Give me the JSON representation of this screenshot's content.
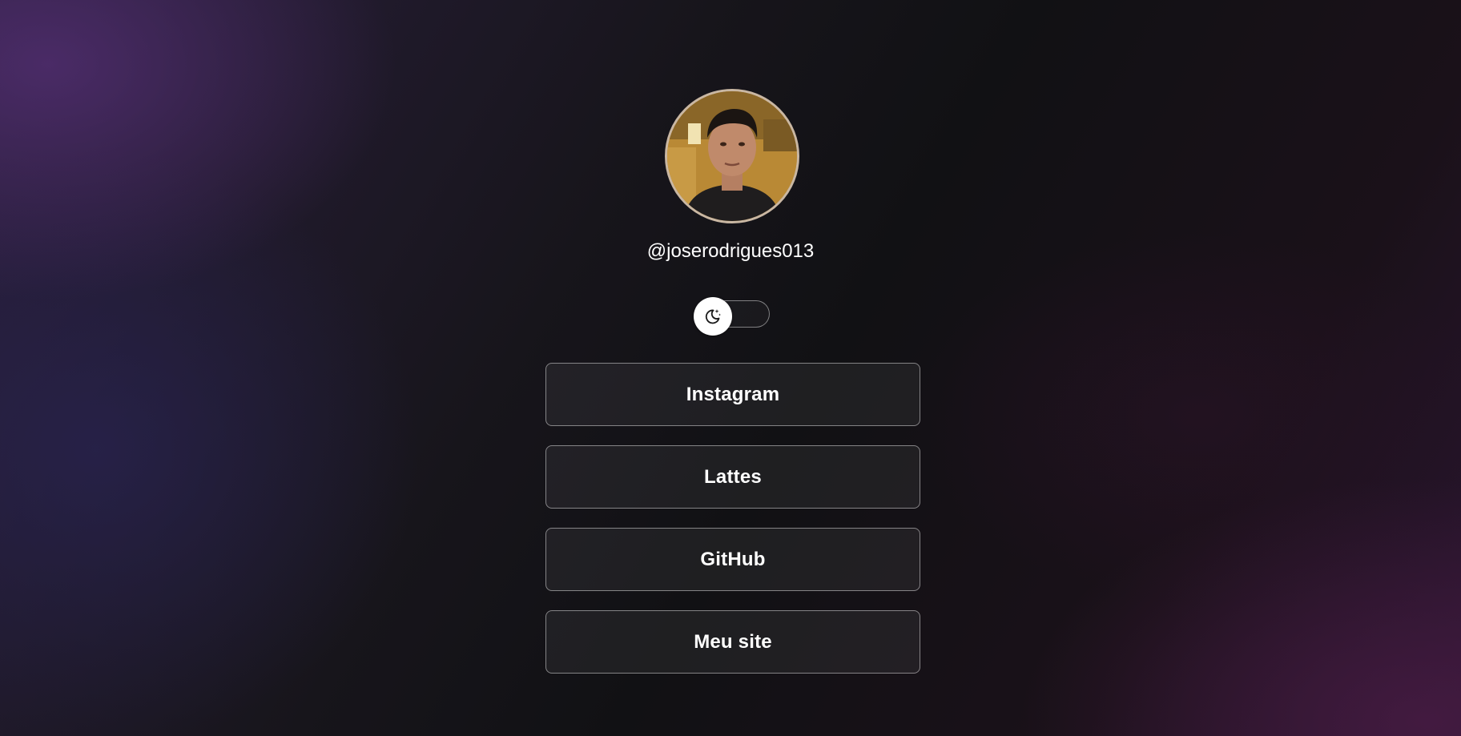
{
  "profile": {
    "handle": "@joserodrigues013",
    "avatar_icon": "profile-photo"
  },
  "theme_toggle": {
    "icon": "moon-stars-icon",
    "state": "dark"
  },
  "links": [
    {
      "label": "Instagram"
    },
    {
      "label": "Lattes"
    },
    {
      "label": "GitHub"
    },
    {
      "label": "Meu site"
    }
  ],
  "colors": {
    "background": "#121114",
    "accent_purple": "#3d2a55",
    "button_border": "#8a8690",
    "text": "#ffffff"
  }
}
